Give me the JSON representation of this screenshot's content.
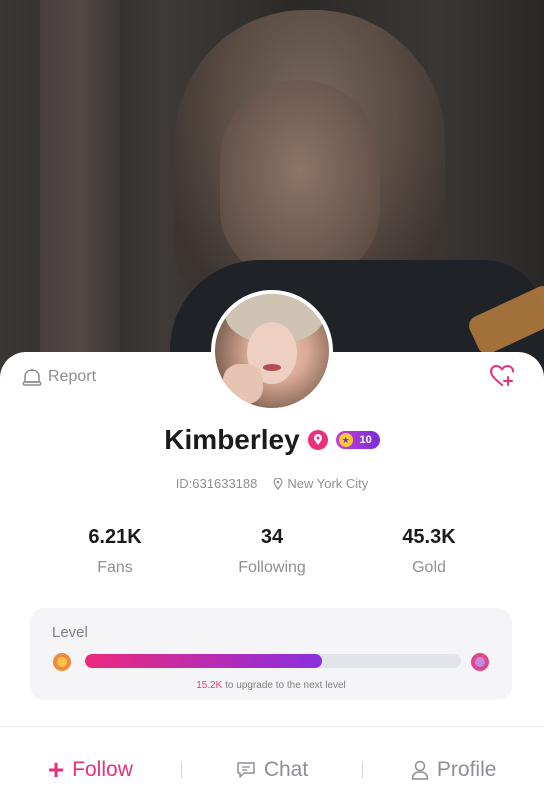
{
  "header": {
    "report_label": "Report"
  },
  "profile": {
    "name": "Kimberley",
    "level_badge": "10",
    "id_text": "ID:631633188",
    "location": "New York City"
  },
  "stats": [
    {
      "value": "6.21K",
      "label": "Fans"
    },
    {
      "value": "34",
      "label": "Following"
    },
    {
      "value": "45.3K",
      "label": "Gold"
    }
  ],
  "level": {
    "title": "Level",
    "progress": 0.63,
    "remaining": "15.2K",
    "note": " to upgrade to the next level"
  },
  "actions": {
    "follow_label": "Follow",
    "chat_label": "Chat",
    "profile_label": "Profile"
  },
  "colors": {
    "accent": "#ea2f7c",
    "purple": "#8a2ee0",
    "muted": "#8e9096"
  },
  "icons": {
    "report": "report-icon",
    "favorite": "heart-plus-icon",
    "location": "location-pin-icon",
    "chat": "chat-bubble-icon",
    "profile": "user-icon"
  }
}
